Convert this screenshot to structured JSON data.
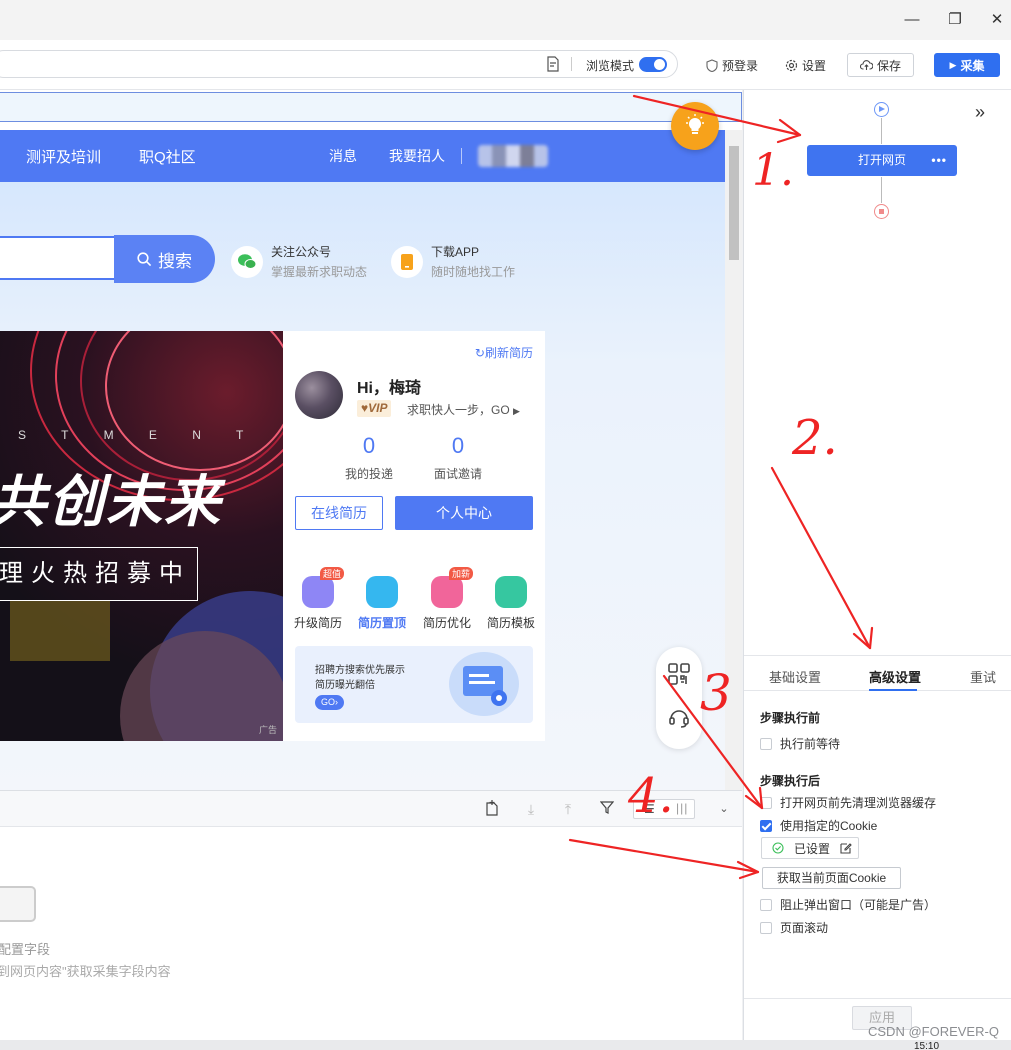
{
  "window": {
    "minimize": "—",
    "restore": "❐",
    "close": "✕"
  },
  "toolbar": {
    "browse_mode_label": "浏览模式",
    "pre_login_label": "预登录",
    "settings_label": "设置",
    "save_label": "保存",
    "collect_label": "采集",
    "browse_mode_on": true
  },
  "site": {
    "nav": [
      "测评及培训",
      "职Q社区",
      "消息",
      "我要招人"
    ],
    "search_button": "搜索",
    "promo": [
      {
        "title": "关注公众号",
        "subtitle": "掌握最新求职动态"
      },
      {
        "title": "下载APP",
        "subtitle": "随时随地找工作"
      }
    ],
    "banner": {
      "small_text": "S T M E N T",
      "big_text": "共创未来",
      "box_text": "理火热招募中",
      "ad_label": "广告"
    },
    "card": {
      "refresh": "刷新简历",
      "greeting": "Hi，梅琦",
      "vip": "VIP",
      "vip_tagline": "求职快人一步，GO",
      "stats": [
        {
          "value": "0",
          "label": "我的投递"
        },
        {
          "value": "0",
          "label": "面试邀请"
        }
      ],
      "btn_online_resume": "在线简历",
      "btn_personal_center": "个人中心",
      "features": [
        {
          "label": "升级简历",
          "tag": "超值",
          "color": "#8e86f5"
        },
        {
          "label": "简历置顶",
          "tag": "",
          "color": "#35b7ef"
        },
        {
          "label": "简历优化",
          "tag": "加薪",
          "color": "#f1659a"
        },
        {
          "label": "简历模板",
          "tag": "",
          "color": "#36c7a0"
        }
      ],
      "promo_line1": "招聘方搜索优先展示",
      "promo_line2": "简历曝光翻倍",
      "promo_go": "GO›"
    }
  },
  "data_panel": {
    "empty_title": "配置字段",
    "empty_hint": "到网页内容\"获取采集字段内容"
  },
  "flow": {
    "node_label": "打开网页",
    "node_more": "•••"
  },
  "settings": {
    "tabs": [
      "基础设置",
      "高级设置",
      "重试"
    ],
    "active_tab": "高级设置",
    "before_title": "步骤执行前",
    "before_options": [
      {
        "label": "执行前等待",
        "checked": false
      }
    ],
    "after_title": "步骤执行后",
    "opt_clear_cache": "打开网页前先清理浏览器缓存",
    "opt_use_cookie": "使用指定的Cookie",
    "cookie_status": "已设置",
    "get_cookie_button": "获取当前页面Cookie",
    "opt_block_popup": "阻止弹出窗口（可能是广告）",
    "opt_scroll": "页面滚动",
    "apply_button": "应用"
  },
  "annotations": {
    "n1": "1.",
    "n2": "2.",
    "n3": "3",
    "n4": "4."
  },
  "watermark": "CSDN @FOREVER-Q",
  "clock": "15:10",
  "colors": {
    "accent": "#2f6ff0",
    "site_blue": "#4f79f3",
    "annotation_red": "#ee2424"
  }
}
